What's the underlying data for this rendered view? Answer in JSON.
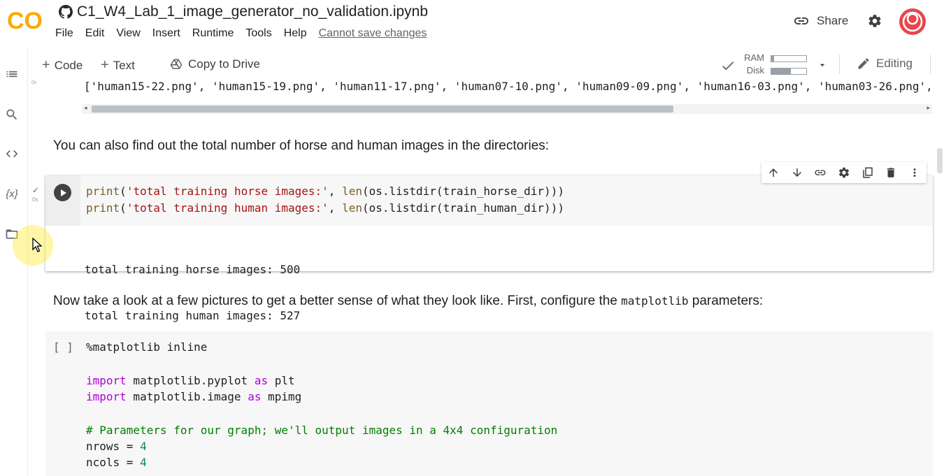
{
  "header": {
    "logo_text": "CO",
    "notebook_title": "C1_W4_Lab_1_image_generator_no_validation.ipynb",
    "menu": [
      "File",
      "Edit",
      "View",
      "Insert",
      "Runtime",
      "Tools",
      "Help"
    ],
    "save_status": "Cannot save changes",
    "share_label": "Share"
  },
  "toolbar": {
    "add_code": "Code",
    "add_text": "Text",
    "copy_to_drive": "Copy to Drive",
    "ram_label": "RAM",
    "disk_label": "Disk",
    "ram_usage_fraction": 0.08,
    "disk_usage_fraction": 0.55,
    "editing_label": "Editing"
  },
  "previous_output": {
    "line": "['human15-22.png', 'human15-19.png', 'human11-17.png', 'human07-10.png', 'human09-09.png', 'human16-03.png', 'human03-26.png',"
  },
  "text_cell_1": "You can also find out the total number of horse and human images in the directories:",
  "code_cell_1": {
    "exec_time": "0s",
    "line1": {
      "fn": "print",
      "open": "(",
      "str": "'total training horse images:'",
      "mid": ", ",
      "fn2": "len",
      "rest": "(os.listdir(train_horse_dir)))"
    },
    "line2": {
      "fn": "print",
      "open": "(",
      "str": "'total training human images:'",
      "mid": ", ",
      "fn2": "len",
      "rest": "(os.listdir(train_human_dir)))"
    },
    "output": [
      "total training horse images: 500",
      "total training human images: 527"
    ]
  },
  "text_cell_2": {
    "before": "Now take a look at a few pictures to get a better sense of what they look like. First, configure the ",
    "code": "matplotlib",
    "after": " parameters:"
  },
  "code_cell_2": {
    "brackets": "[ ]",
    "line1": "%matplotlib inline",
    "line2": {
      "kw": "import",
      "mid": " matplotlib.pyplot ",
      "kw2": "as",
      "end": " plt"
    },
    "line3": {
      "kw": "import",
      "mid": " matplotlib.image ",
      "kw2": "as",
      "end": " mpimg"
    },
    "comment": "# Parameters for our graph; we'll output images in a 4x4 configuration",
    "nrows": {
      "name": "nrows = ",
      "value": "4"
    },
    "ncols": {
      "name": "ncols = ",
      "value": "4"
    }
  },
  "colors": {
    "logo_orange": "#f9ab00",
    "logo_dark_orange": "#e37400",
    "avatar_red": "#e8474c"
  }
}
